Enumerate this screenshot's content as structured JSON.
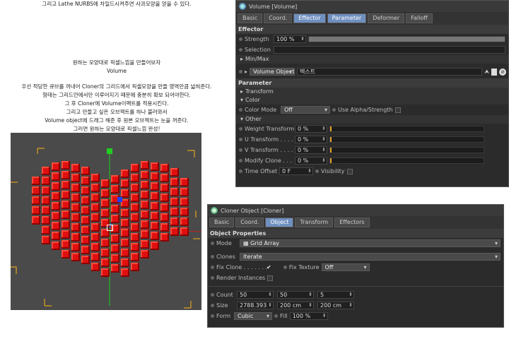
{
  "tutorial": {
    "line_top": "그리고 Lathe NURBS에 차일드시켜주면 사과모양을 얻을 수 있다.",
    "line_intro": "원하는 모양대로 픽셀느낌을 만들어보자",
    "heading": "Volume",
    "lines": [
      "우선 적당한 큐브를 꺼내어 Cloner의 그리드에서 픽셀모양을 만들 영역만큼 넓혀준다.",
      "형태는 그리드안에서만 이루어지기 때문에 충분히 확보 되어야한다.",
      "그 후 Cloner에 Volume이펙트를 적용시킨다.",
      "그리고 만들고 싶은 오브젝트를 하나 불러와서",
      "Volume object에 드래그 해준 후 원본 오브젝트는 눈을 꺼준다.",
      "그러면 원하는 모양대로 픽셀느낌 완성!"
    ]
  },
  "volume_panel": {
    "title": "Volume [Volume]",
    "tabs": [
      "Basic",
      "Coord.",
      "Effector",
      "Parameter",
      "Deformer",
      "Falloff"
    ],
    "active_tabs": [
      2,
      3
    ],
    "effector_section": "Effector",
    "strength_label": "Strength",
    "strength_value": "100 %",
    "strength_fraction": 1.0,
    "selection_label": "Selection",
    "minmax_label": "Min/Max",
    "volume_object_label": "Volume Object",
    "volume_object_value": "텍스트",
    "parameter_section": "Parameter",
    "transform_label": "Transform",
    "color_label": "Color",
    "color_mode_label": "Color Mode",
    "color_mode_value": "Off",
    "use_alpha_label": "Use Alpha/Strength",
    "other_label": "Other",
    "weight_label": "Weight Transform",
    "weight_value": "0 %",
    "u_label": "U Transform . . . .",
    "u_value": "0 %",
    "v_label": "V Transform . . . .",
    "v_value": "0 %",
    "modify_label": "Modify Clone . . .",
    "modify_value": "0 %",
    "time_offset_label": "Time Offset",
    "time_offset_value": "0 F",
    "visibility_label": "Visibility"
  },
  "cloner_panel": {
    "title": "Cloner Object [Cloner]",
    "tabs": [
      "Basic",
      "Coord.",
      "Object",
      "Transform",
      "Effectors"
    ],
    "active_tab": 2,
    "section": "Object Properties",
    "mode_label": "Mode",
    "mode_value": "Grid Array",
    "clones_label": "Clones",
    "clones_value": "Iterate",
    "fix_clone_label": "Fix Clone . . . . . . .",
    "fix_clone_mark": "✔",
    "fix_texture_label": "Fix Texture",
    "fix_texture_value": "Off",
    "render_instances_label": "Render Instances",
    "count_label": "Count",
    "count": [
      "50",
      "50",
      "5"
    ],
    "size_label": "Size",
    "size": [
      "2788.393",
      "200 cm",
      "200 cm"
    ],
    "form_label": "Form",
    "form_value": "Cubic",
    "fill_label": "Fill",
    "fill_value": "100 %"
  },
  "colors": {
    "accent_tab": "#6f8fbf",
    "clone_red": "#e01010",
    "axis_green": "#22cc22",
    "bbox_orange": "#e0a020"
  }
}
